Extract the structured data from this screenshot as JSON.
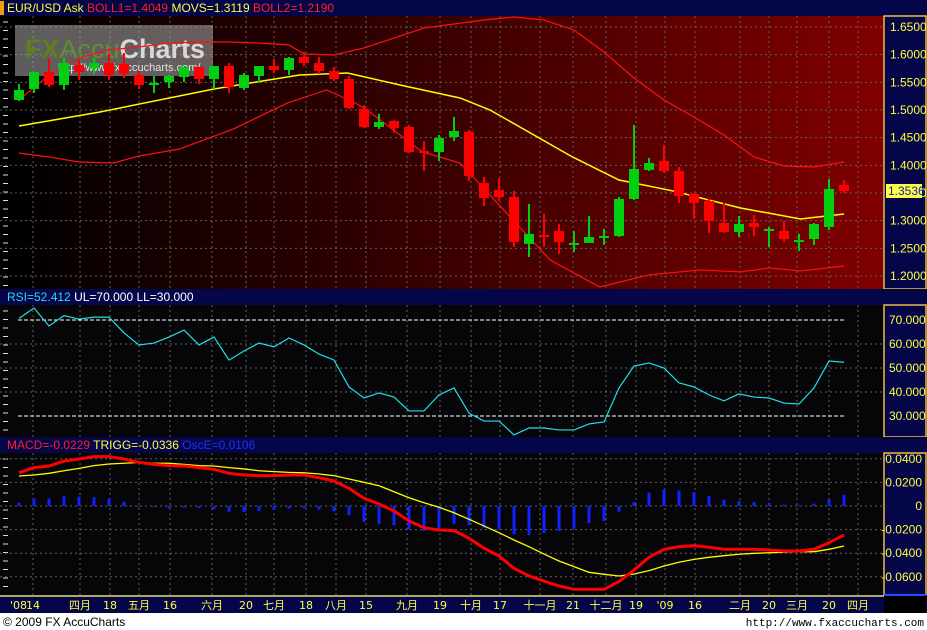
{
  "colors": {
    "header_bg": "#05054a",
    "axis_border": "#e8c040",
    "bull": "#00d010",
    "bear": "#ff0000",
    "ma": "#ffff00",
    "band": "#ff1010",
    "rsi": "#20e0e8",
    "macd": "#ff0000",
    "trigger": "#ffff00",
    "osc": "#1020ff"
  },
  "price_panel": {
    "symbol": "EUR/USD Ask",
    "boll1": "BOLL1=1.4049",
    "movs": "MOVS=1.3119",
    "boll2": "BOLL2=1.2190",
    "current_price": "1.3536"
  },
  "rsi_panel": {
    "rsi": "RSI=52.412",
    "ul_ll": "UL=70.000 LL=30.000"
  },
  "macd_panel": {
    "macd": "MACD=-0.0229",
    "trigg": "TRIGG=-0.0336",
    "osce": "OscE=0.0106"
  },
  "watermark": {
    "brand_fx": "FX",
    "brand_accu": "Accu",
    "brand_charts": "Charts",
    "url": "http://www.fxaccucharts.com/"
  },
  "footer": {
    "copyright": "© 2009 FX AccuCharts",
    "url": "http://www.fxaccucharts.com"
  },
  "chart_data": [
    {
      "type": "candlestick",
      "title": "EUR/USD Ask",
      "ylim": [
        1.18,
        1.67
      ],
      "yticks": [
        "1.6500",
        "1.6000",
        "1.5500",
        "1.5000",
        "1.4500",
        "1.4000",
        "1.3500",
        "1.3000",
        "1.2500",
        "1.2000"
      ],
      "ytick_values": [
        1.65,
        1.6,
        1.55,
        1.5,
        1.45,
        1.4,
        1.35,
        1.3,
        1.25,
        1.2
      ],
      "xticks": [
        "'08",
        "14",
        "四月",
        "18",
        "五月",
        "16",
        "六月",
        "20",
        "七月",
        "18",
        "八月",
        "15",
        "九月",
        "19",
        "十月",
        "17",
        "十一月",
        "21",
        "十二月",
        "19",
        "'09",
        "16",
        "二月",
        "20",
        "三月",
        "20",
        "四月"
      ],
      "ohlc": [
        [
          1.5181,
          1.547,
          1.5163,
          1.5362
        ],
        [
          1.538,
          1.5687,
          1.5307,
          1.5687
        ],
        [
          1.5687,
          1.5922,
          1.5416,
          1.5452
        ],
        [
          1.5452,
          1.594,
          1.5362,
          1.5849
        ],
        [
          1.5813,
          1.5904,
          1.5542,
          1.5687
        ],
        [
          1.5759,
          1.594,
          1.5651,
          1.5849
        ],
        [
          1.5849,
          1.6012,
          1.5542,
          1.5633
        ],
        [
          1.5831,
          1.603,
          1.5578,
          1.5651
        ],
        [
          1.5633,
          1.5705,
          1.538,
          1.5452
        ],
        [
          1.5452,
          1.5615,
          1.5307,
          1.5488
        ],
        [
          1.5506,
          1.5633,
          1.5398,
          1.5615
        ],
        [
          1.5596,
          1.5777,
          1.5506,
          1.5777
        ],
        [
          1.5777,
          1.5777,
          1.547,
          1.556
        ],
        [
          1.556,
          1.5795,
          1.538,
          1.5795
        ],
        [
          1.5795,
          1.5849,
          1.5307,
          1.5416
        ],
        [
          1.5398,
          1.5669,
          1.5362,
          1.5633
        ],
        [
          1.5615,
          1.5795,
          1.5488,
          1.5795
        ],
        [
          1.5795,
          1.5922,
          1.5669,
          1.5723
        ],
        [
          1.5723,
          1.5958,
          1.5633,
          1.594
        ],
        [
          1.5958,
          1.6048,
          1.5795,
          1.5849
        ],
        [
          1.5849,
          1.5958,
          1.5651,
          1.5705
        ],
        [
          1.5705,
          1.5777,
          1.5524,
          1.556
        ],
        [
          1.556,
          1.5615,
          1.5018,
          1.5036
        ],
        [
          1.5018,
          1.5091,
          1.4675,
          1.4693
        ],
        [
          1.4693,
          1.4928,
          1.4657,
          1.4783
        ],
        [
          1.4801,
          1.4819,
          1.4585,
          1.4675
        ],
        [
          1.4693,
          1.4729,
          1.4223,
          1.4241
        ],
        [
          1.4259,
          1.444,
          1.3898,
          1.4241
        ],
        [
          1.4241,
          1.4548,
          1.4079,
          1.4494
        ],
        [
          1.4512,
          1.4874,
          1.444,
          1.4621
        ],
        [
          1.4603,
          1.4639,
          1.3717,
          1.3808
        ],
        [
          1.3681,
          1.3789,
          1.3266,
          1.341
        ],
        [
          1.3555,
          1.3771,
          1.3356,
          1.3428
        ],
        [
          1.3428,
          1.3537,
          1.2525,
          1.2615
        ],
        [
          1.2579,
          1.3302,
          1.2344,
          1.276
        ],
        [
          1.2741,
          1.3121,
          1.2525,
          1.2723
        ],
        [
          1.2814,
          1.294,
          1.2398,
          1.2615
        ],
        [
          1.2561,
          1.2814,
          1.2434,
          1.2597
        ],
        [
          1.2597,
          1.3085,
          1.2597,
          1.2705
        ],
        [
          1.2705,
          1.285,
          1.2561,
          1.2723
        ],
        [
          1.2723,
          1.3428,
          1.2705,
          1.3392
        ],
        [
          1.3392,
          1.4729,
          1.3374,
          1.3934
        ],
        [
          1.3916,
          1.4133,
          1.3898,
          1.4042
        ],
        [
          1.4079,
          1.4368,
          1.3862,
          1.3898
        ],
        [
          1.3898,
          1.397,
          1.332,
          1.3446
        ],
        [
          1.3482,
          1.35,
          1.3031,
          1.332
        ],
        [
          1.3356,
          1.3392,
          1.2778,
          1.2994
        ],
        [
          1.2958,
          1.332,
          1.2778,
          1.2796
        ],
        [
          1.2796,
          1.3085,
          1.2705,
          1.294
        ],
        [
          1.2958,
          1.3103,
          1.2723,
          1.2886
        ],
        [
          1.2814,
          1.2886,
          1.2525,
          1.285
        ],
        [
          1.2814,
          1.2994,
          1.2615,
          1.2669
        ],
        [
          1.2633,
          1.276,
          1.2452,
          1.2651
        ],
        [
          1.2669,
          1.2958,
          1.2561,
          1.294
        ],
        [
          1.2886,
          1.3753,
          1.2832,
          1.3573
        ],
        [
          1.3645,
          1.3735,
          1.35,
          1.3537
        ]
      ],
      "series": [
        {
          "name": "BOLL1",
          "points": [
            [
              1,
              1.5181
            ],
            [
              3,
              1.5633
            ],
            [
              5,
              1.594
            ],
            [
              7,
              1.6084
            ],
            [
              9,
              1.6139
            ],
            [
              11,
              1.6211
            ],
            [
              13,
              1.6229
            ],
            [
              15,
              1.6229
            ],
            [
              17,
              1.6211
            ],
            [
              19,
              1.6175
            ],
            [
              20,
              1.6012
            ],
            [
              22,
              1.5994
            ],
            [
              24,
              1.6121
            ],
            [
              26,
              1.6301
            ],
            [
              28,
              1.6482
            ],
            [
              30,
              1.6554
            ],
            [
              32,
              1.6626
            ],
            [
              34,
              1.6681
            ],
            [
              36,
              1.6626
            ],
            [
              38,
              1.6446
            ],
            [
              40,
              1.6048
            ],
            [
              42,
              1.5578
            ],
            [
              44,
              1.5181
            ],
            [
              46,
              1.4874
            ],
            [
              48,
              1.4548
            ],
            [
              50,
              1.4151
            ],
            [
              52,
              1.3988
            ],
            [
              54,
              1.397
            ],
            [
              56,
              1.406
            ]
          ]
        },
        {
          "name": "MOVS",
          "points": [
            [
              1,
              1.4711
            ],
            [
              6.4,
              1.4964
            ],
            [
              14,
              1.538
            ],
            [
              19.7,
              1.5633
            ],
            [
              22.9,
              1.5669
            ],
            [
              26.4,
              1.5452
            ],
            [
              30.4,
              1.5217
            ],
            [
              32.4,
              1.5
            ],
            [
              37.9,
              1.4151
            ],
            [
              41,
              1.3735
            ],
            [
              44.6,
              1.3537
            ],
            [
              49.1,
              1.3229
            ],
            [
              53.1,
              1.3031
            ],
            [
              56,
              1.3121
            ]
          ]
        },
        {
          "name": "BOLL2",
          "points": [
            [
              1,
              1.4223
            ],
            [
              3,
              1.4151
            ],
            [
              5,
              1.406
            ],
            [
              7.3,
              1.4042
            ],
            [
              9,
              1.4169
            ],
            [
              11.7,
              1.4295
            ],
            [
              15.3,
              1.4657
            ],
            [
              18.9,
              1.5127
            ],
            [
              21.5,
              1.5362
            ],
            [
              23.3,
              1.5145
            ],
            [
              24.2,
              1.5
            ],
            [
              27.9,
              1.4241
            ],
            [
              30.4,
              1.4042
            ],
            [
              33.5,
              1.3139
            ],
            [
              36.4,
              1.229
            ],
            [
              39.7,
              1.1802
            ],
            [
              43,
              1.2019
            ],
            [
              46.4,
              1.2109
            ],
            [
              49.1,
              1.2073
            ],
            [
              51,
              1.2145
            ],
            [
              53.1,
              1.2091
            ],
            [
              56,
              1.2181
            ]
          ]
        }
      ]
    },
    {
      "type": "line",
      "title": "RSI",
      "ylim": [
        20,
        75
      ],
      "yticks": [
        "70.000",
        "60.000",
        "50.000",
        "40.000",
        "30.000"
      ],
      "ytick_values": [
        70,
        60,
        50,
        40,
        30
      ],
      "upper_level": 70,
      "lower_level": 30,
      "series": [
        {
          "name": "RSI",
          "values": [
            70.7,
            75,
            67.5,
            71.8,
            70.4,
            71.2,
            71.2,
            64.6,
            59.6,
            60.4,
            62.9,
            65.8,
            59.6,
            62.9,
            53.3,
            57.1,
            60.4,
            58.8,
            62.5,
            59.6,
            55.8,
            53.3,
            42.1,
            37.5,
            39.6,
            37.9,
            32.1,
            32.1,
            38.8,
            41.7,
            31.2,
            27.9,
            27.9,
            22.1,
            25,
            25,
            24.2,
            24.2,
            26.7,
            27.5,
            41.7,
            50.8,
            52.1,
            50,
            43.8,
            42.1,
            38.8,
            36.3,
            39.2,
            37.9,
            37.5,
            35.4,
            35,
            41.7,
            52.9,
            52.4
          ]
        }
      ]
    },
    {
      "type": "line",
      "title": "MACD",
      "ylim": [
        -0.07,
        0.045
      ],
      "yticks": [
        "0.0400",
        "0.0200",
        "0",
        "-0.0200",
        "-0.0400",
        "-0.0600"
      ],
      "ytick_values": [
        0.04,
        0.02,
        0,
        -0.02,
        -0.04,
        -0.06
      ],
      "series": [
        {
          "name": "MACD",
          "values": [
            0.0282,
            0.0325,
            0.0339,
            0.0381,
            0.0398,
            0.0418,
            0.0418,
            0.0398,
            0.037,
            0.0353,
            0.0342,
            0.0339,
            0.0325,
            0.0311,
            0.0277,
            0.0263,
            0.0257,
            0.0257,
            0.0263,
            0.0263,
            0.024,
            0.0212,
            0.015,
            0.0065,
            0.0017,
            -0.0042,
            -0.0127,
            -0.0184,
            -0.0203,
            -0.0209,
            -0.0274,
            -0.0358,
            -0.0424,
            -0.0528,
            -0.0593,
            -0.0636,
            -0.0678,
            -0.0706,
            -0.0706,
            -0.0706,
            -0.0641,
            -0.0542,
            -0.0435,
            -0.0367,
            -0.0345,
            -0.0336,
            -0.035,
            -0.0367,
            -0.0367,
            -0.0367,
            -0.0373,
            -0.0381,
            -0.0381,
            -0.0367,
            -0.0311,
            -0.0246
          ]
        },
        {
          "name": "TRIGG",
          "values": [
            0.0254,
            0.0263,
            0.0277,
            0.0299,
            0.0319,
            0.0342,
            0.0356,
            0.0362,
            0.037,
            0.0362,
            0.0362,
            0.0353,
            0.0342,
            0.0339,
            0.0325,
            0.0314,
            0.0299,
            0.0291,
            0.0285,
            0.0282,
            0.0271,
            0.0257,
            0.0229,
            0.0201,
            0.0172,
            0.0121,
            0.007,
            0.0028,
            -0.0011,
            -0.0057,
            -0.0113,
            -0.0169,
            -0.0226,
            -0.0288,
            -0.0345,
            -0.0407,
            -0.0466,
            -0.0514,
            -0.0562,
            -0.0579,
            -0.0593,
            -0.0576,
            -0.0548,
            -0.0508,
            -0.0477,
            -0.0452,
            -0.0435,
            -0.0421,
            -0.0409,
            -0.0401,
            -0.0396,
            -0.0392,
            -0.0387,
            -0.0387,
            -0.0367,
            -0.0339
          ]
        },
        {
          "name": "OscE",
          "type": "bar",
          "values": [
            0.0028,
            0.0062,
            0.0062,
            0.0082,
            0.0079,
            0.0076,
            0.0062,
            0.0036,
            0.0,
            -0.0009,
            -0.002,
            -0.0014,
            -0.0017,
            -0.0028,
            -0.0048,
            -0.0051,
            -0.0042,
            -0.0034,
            -0.0022,
            -0.0019,
            -0.0031,
            -0.0045,
            -0.0079,
            -0.0136,
            -0.0155,
            -0.0163,
            -0.0197,
            -0.0212,
            -0.0192,
            -0.0152,
            -0.0161,
            -0.0189,
            -0.0198,
            -0.024,
            -0.0248,
            -0.0229,
            -0.0212,
            -0.0192,
            -0.0144,
            -0.0127,
            -0.0048,
            0.0034,
            0.0113,
            0.0141,
            0.0132,
            0.0116,
            0.0085,
            0.0054,
            0.0042,
            0.0034,
            0.0023,
            0.0011,
            0.0006,
            0.002,
            0.0056,
            0.0093
          ]
        }
      ]
    }
  ]
}
